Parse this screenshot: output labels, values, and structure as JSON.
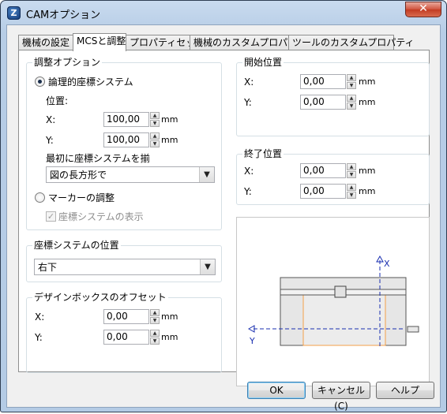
{
  "window": {
    "title": "CAMオプション",
    "app_icon_glyph": "Z",
    "close_glyph": "✕"
  },
  "tabs": [
    {
      "label": "機械の設定",
      "active": false
    },
    {
      "label": "MCSと調整",
      "active": true
    },
    {
      "label": "プロパティセット",
      "active": false
    },
    {
      "label": "機械のカスタムプロパティ",
      "active": false
    },
    {
      "label": "ツールのカスタムプロパティ",
      "active": false
    }
  ],
  "adjust_options": {
    "title": "調整オプション",
    "logical_cs_label": "論理的座標システム",
    "position_label": "位置:",
    "x_label": "X:",
    "x_value": "100,00",
    "x_unit": "mm",
    "y_label": "Y:",
    "y_value": "100,00",
    "y_unit": "mm",
    "align_label": "最初に座標システムを揃",
    "align_value": "図の長方形で",
    "marker_label": "マーカーの調整",
    "show_cs_label": "座標システムの表示"
  },
  "cs_position": {
    "title": "座標システムの位置",
    "value": "右下"
  },
  "design_offset": {
    "title": "デザインボックスのオフセット",
    "x_label": "X:",
    "x_value": "0,00",
    "x_unit": "mm",
    "y_label": "Y:",
    "y_value": "0,00",
    "y_unit": "mm"
  },
  "start_position": {
    "title": "開始位置",
    "x_label": "X:",
    "x_value": "0,00",
    "x_unit": "mm",
    "y_label": "Y:",
    "y_value": "0,00",
    "y_unit": "mm"
  },
  "end_position": {
    "title": "終了位置",
    "x_label": "X:",
    "x_value": "0,00",
    "x_unit": "mm",
    "y_label": "Y:",
    "y_value": "0,00",
    "y_unit": "mm"
  },
  "preview": {
    "axis_x_label": "X",
    "axis_y_label": "Y"
  },
  "buttons": {
    "ok": "OK",
    "cancel": "キャンセル(C)",
    "help": "ヘルプ"
  },
  "colors": {
    "axis": "#1a2fb0",
    "work_area": "#f4a14a",
    "machine_bed": "#e6e6e6"
  },
  "icons": {
    "spin_up": "▲",
    "spin_down": "▼",
    "combo_arrow": "▼",
    "check": "✓"
  }
}
